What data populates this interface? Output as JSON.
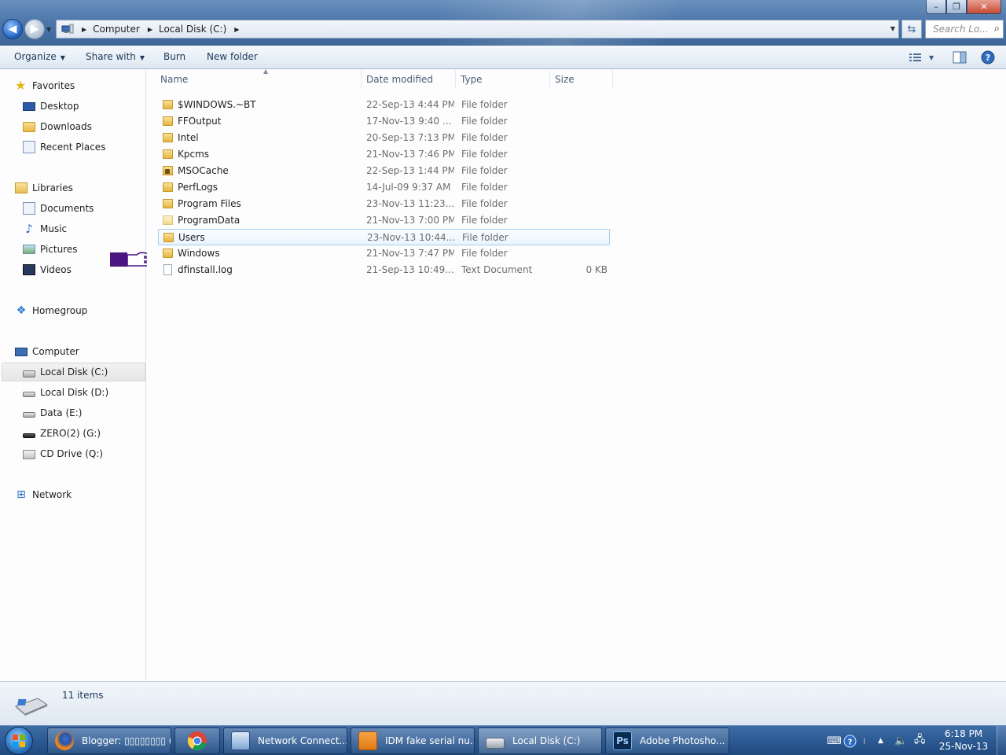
{
  "window": {
    "minimize_label": "–",
    "maximize_label": "❐",
    "close_label": "✕"
  },
  "address": {
    "crumbs": [
      "Computer",
      "Local Disk (C:)"
    ],
    "search_placeholder": "Search Lo..."
  },
  "toolbar": {
    "organize": "Organize",
    "share_with": "Share with",
    "burn": "Burn",
    "new_folder": "New folder"
  },
  "nav": {
    "favorites": "Favorites",
    "desktop": "Desktop",
    "downloads": "Downloads",
    "recent_places": "Recent Places",
    "libraries": "Libraries",
    "documents": "Documents",
    "music": "Music",
    "pictures": "Pictures",
    "videos": "Videos",
    "homegroup": "Homegroup",
    "computer": "Computer",
    "local_c": "Local Disk (C:)",
    "local_d": "Local Disk (D:)",
    "data_e": "Data (E:)",
    "zero_g": "ZERO(2) (G:)",
    "cd_q": "CD Drive (Q:)",
    "network": "Network"
  },
  "columns": {
    "name": "Name",
    "date": "Date modified",
    "type": "Type",
    "size": "Size"
  },
  "files": [
    {
      "name": "$WINDOWS.~BT",
      "date": "22-Sep-13 4:44 PM",
      "type": "File folder",
      "size": "",
      "icon": "folder"
    },
    {
      "name": "FFOutput",
      "date": "17-Nov-13 9:40 ...",
      "type": "File folder",
      "size": "",
      "icon": "folder"
    },
    {
      "name": "Intel",
      "date": "20-Sep-13 7:13 PM",
      "type": "File folder",
      "size": "",
      "icon": "folder"
    },
    {
      "name": "Kpcms",
      "date": "21-Nov-13 7:46 PM",
      "type": "File folder",
      "size": "",
      "icon": "folder"
    },
    {
      "name": "MSOCache",
      "date": "22-Sep-13 1:44 PM",
      "type": "File folder",
      "size": "",
      "icon": "folder-lock"
    },
    {
      "name": "PerfLogs",
      "date": "14-Jul-09 9:37 AM",
      "type": "File folder",
      "size": "",
      "icon": "folder"
    },
    {
      "name": "Program Files",
      "date": "23-Nov-13 11:23...",
      "type": "File folder",
      "size": "",
      "icon": "folder"
    },
    {
      "name": "ProgramData",
      "date": "21-Nov-13 7:00 PM",
      "type": "File folder",
      "size": "",
      "icon": "folder-pale"
    },
    {
      "name": "Users",
      "date": "23-Nov-13 10:44...",
      "type": "File folder",
      "size": "",
      "icon": "folder"
    },
    {
      "name": "Windows",
      "date": "21-Nov-13 7:47 PM",
      "type": "File folder",
      "size": "",
      "icon": "folder"
    },
    {
      "name": "dfinstall.log",
      "date": "21-Sep-13 10:49...",
      "type": "Text Document",
      "size": "0 KB",
      "icon": "text-file"
    }
  ],
  "status": {
    "item_count": "11 items"
  },
  "taskbar": {
    "firefox": "Blogger: ▯▯▯▯▯▯▯▯ (▯▯...",
    "network": "Network Connect...",
    "idm": "IDM fake serial nu...",
    "explorer": "Local Disk (C:)",
    "photoshop": "Adobe Photosho..."
  },
  "clock": {
    "time": "6:18 PM",
    "date": "25-Nov-13"
  },
  "colors": {
    "selection_border": "#a7cdf0",
    "titlebar": "#4e78ab",
    "taskbar": "#2c5a93",
    "pointer_hand": "#4b1681"
  }
}
